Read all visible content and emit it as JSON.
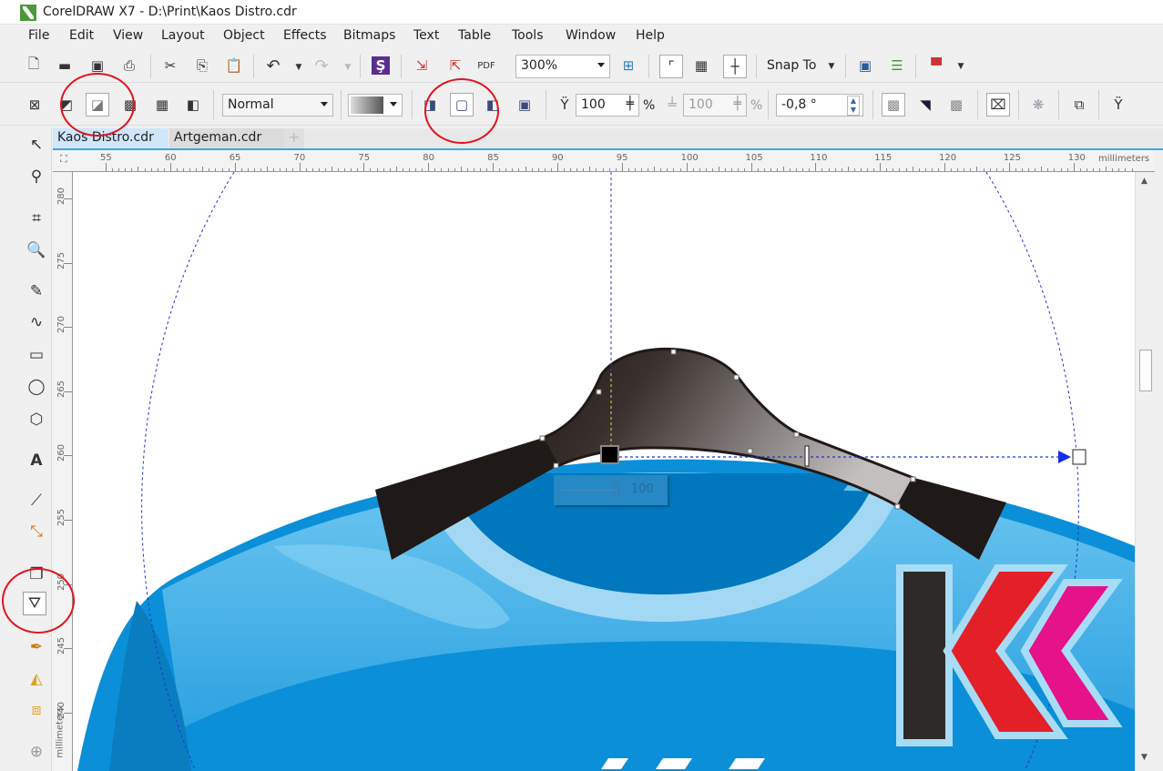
{
  "window": {
    "title": "CorelDRAW X7 - D:\\Print\\Kaos Distro.cdr"
  },
  "menu": [
    "File",
    "Edit",
    "View",
    "Layout",
    "Object",
    "Effects",
    "Bitmaps",
    "Text",
    "Table",
    "Tools",
    "Window",
    "Help"
  ],
  "standard_toolbar": {
    "zoom_level": "300%",
    "snap_to": "Snap To"
  },
  "property_bar": {
    "blend_mode": "Normal",
    "transparency": "100",
    "transparency_unit": "%",
    "feather": "100",
    "feather_unit": "%",
    "angle": "-0,8 °"
  },
  "tabs": [
    {
      "label": "Kaos Distro.cdr",
      "active": true
    },
    {
      "label": "Artgeman.cdr",
      "active": false
    }
  ],
  "rulers": {
    "unit": "millimeters",
    "horizontal": [
      "55",
      "60",
      "65",
      "70",
      "75",
      "80",
      "85",
      "90",
      "95",
      "100",
      "105",
      "110",
      "115",
      "120",
      "125",
      "130"
    ],
    "vertical": [
      "280",
      "275",
      "270",
      "265",
      "260",
      "255",
      "250",
      "245",
      "240"
    ]
  },
  "canvas": {
    "transparency_slider_value": "100",
    "slider_fraction": 1.0
  },
  "colors": {
    "shirt": "#0b8fd8",
    "collar": "#1f1a17",
    "logo_red": "#e32028",
    "logo_magenta": "#e5128a",
    "annotation": "#e0141c"
  }
}
